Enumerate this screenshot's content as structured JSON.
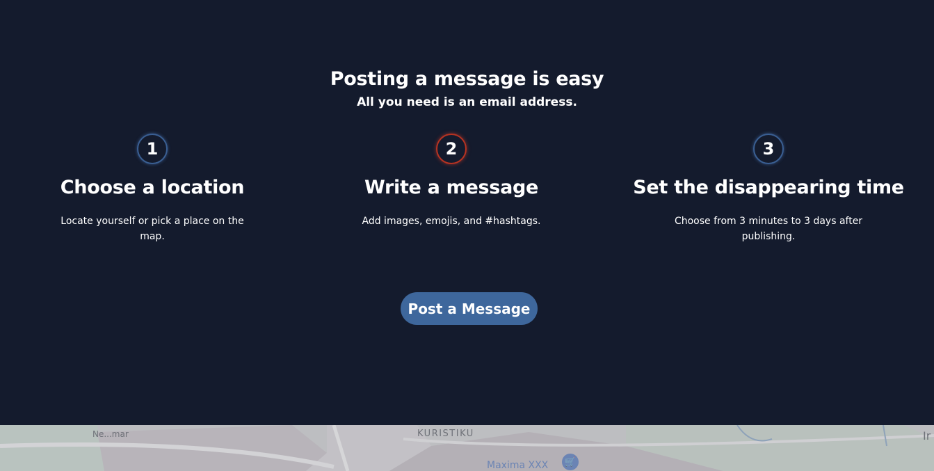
{
  "hero": {
    "title": "Posting a message is easy",
    "subtitle": "All you need is an email address."
  },
  "steps": [
    {
      "number": "1",
      "title": "Choose a location",
      "description": "Locate yourself or pick a place on the map.",
      "ring_color": "#3a5f93"
    },
    {
      "number": "2",
      "title": "Write a message",
      "description": "Add images, emojis, and #hashtags.",
      "ring_color": "#b73322"
    },
    {
      "number": "3",
      "title": "Set the disappearing time",
      "description": "Choose from 3 minutes to 3 days after publishing.",
      "ring_color": "#3a5f93"
    }
  ],
  "cta": {
    "label": "Post a Message",
    "color": "#3e679c"
  },
  "map": {
    "district_label": "KURISTIKU",
    "street_label_left": "Ne...mar",
    "poi_label": "Maxima XXX",
    "poi_icon": "shopping-cart-icon",
    "edge_label": "Ir"
  },
  "colors": {
    "background": "#141b2d",
    "text": "#ffffff"
  }
}
